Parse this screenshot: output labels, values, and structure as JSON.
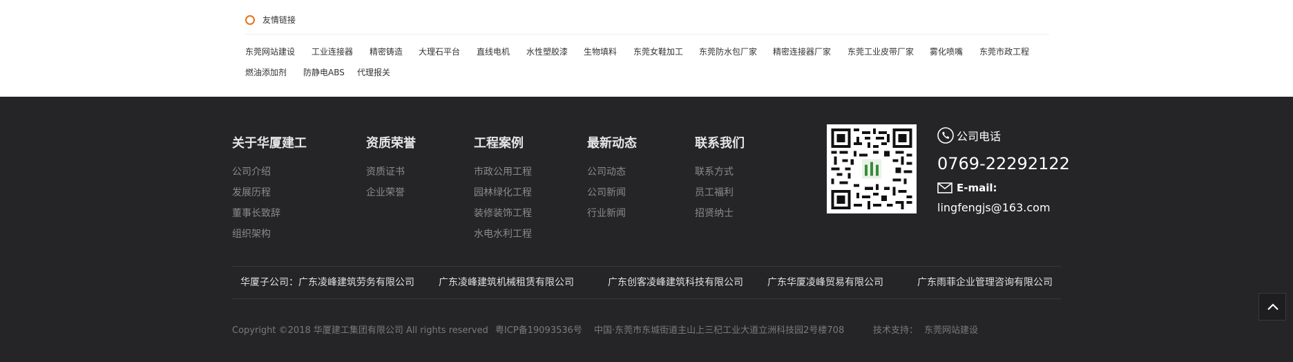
{
  "friendly_links": {
    "title": "友情链接",
    "items": [
      "东莞网站建设",
      "工业连接器",
      "精密铸造",
      "大理石平台",
      "直线电机",
      "水性塑胶漆",
      "生物填料",
      "东莞女鞋加工",
      "东莞防水包厂家",
      "精密连接器厂家",
      "东莞工业皮带厂家",
      "雾化喷嘴",
      "东莞市政工程",
      "燃油添加剂",
      "防静电ABS",
      "代理报关"
    ]
  },
  "footer": {
    "columns": [
      {
        "title": "关于华厦建工",
        "links": [
          "公司介绍",
          "发展历程",
          "董事长致辞",
          "组织架构"
        ]
      },
      {
        "title": "资质荣誉",
        "links": [
          "资质证书",
          "企业荣誉"
        ]
      },
      {
        "title": "工程案例",
        "links": [
          "市政公用工程",
          "园林绿化工程",
          "装修装饰工程",
          "水电水利工程"
        ]
      },
      {
        "title": "最新动态",
        "links": [
          "公司动态",
          "公司新闻",
          "行业新闻"
        ]
      },
      {
        "title": "联系我们",
        "links": [
          "联系方式",
          "员工福利",
          "招贤纳士"
        ]
      }
    ],
    "contact": {
      "phone_icon": "phone-icon",
      "phone_label": "公司电话",
      "phone_number": "0769-22292122",
      "mail_icon": "mail-icon",
      "email_label": "E-mail:",
      "email": "lingfengjs@163.com"
    },
    "subsidiaries": [
      "华厦子公司：广东凌峰建筑劳务有限公司",
      "广东凌峰建筑机械租赁有限公司",
      "广东创客凌峰建筑科技有限公司",
      "广东华厦凌峰贸易有限公司",
      "广东雨菲企业管理咨询有限公司"
    ],
    "copyright": "Copyright ©2018 华厦建工集团有限公司 All rights reserved",
    "icp": "粤ICP备19093536号",
    "address": "中国·东莞市东城街道主山上三杞工业大道立洲科技园2号楼708",
    "tech_support_label": "技术支持：",
    "tech_support_link": "东莞网站建设"
  },
  "back_to_top_icon": "chevron-up-icon",
  "colors": {
    "footer_bg": "#252527",
    "accent_circle": "#e8701a"
  }
}
